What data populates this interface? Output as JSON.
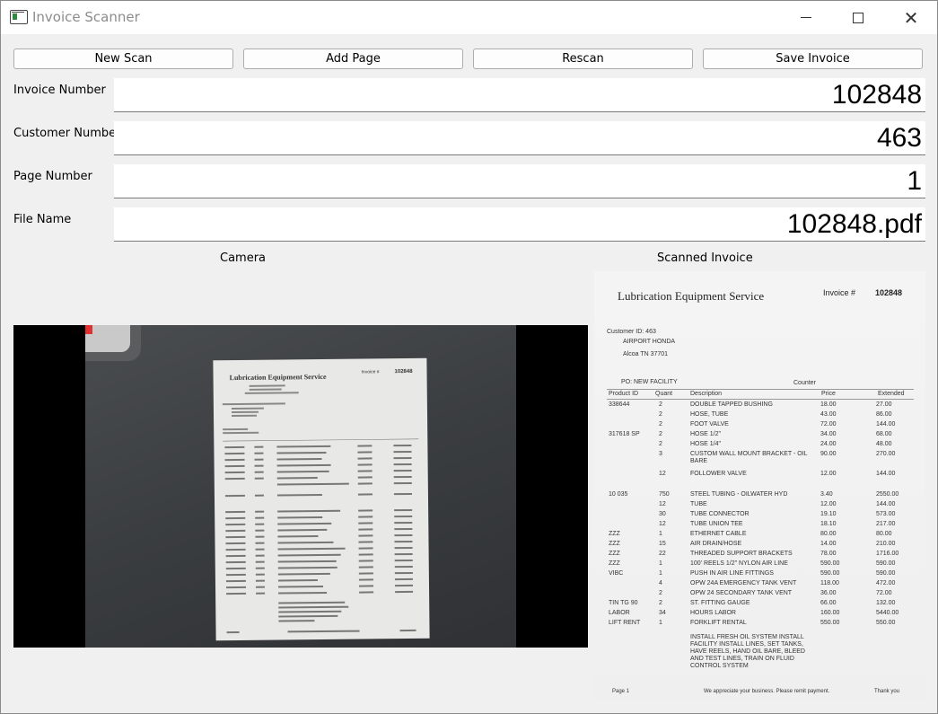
{
  "window": {
    "title": "Invoice Scanner"
  },
  "toolbar": {
    "new_scan": "New Scan",
    "add_page": "Add Page",
    "rescan": "Rescan",
    "save_invoice": "Save Invoice"
  },
  "form": {
    "invoice_number_label": "Invoice Number",
    "invoice_number_value": "102848",
    "customer_number_label": "Customer Number",
    "customer_number_value": "463",
    "page_number_label": "Page Number",
    "page_number_value": "1",
    "file_name_label": "File Name",
    "file_name_value": "102848.pdf"
  },
  "sections": {
    "camera": "Camera",
    "scanned_invoice": "Scanned Invoice"
  },
  "invoice": {
    "company": "Lubrication Equipment Service",
    "invoice_label": "Invoice #",
    "invoice_no": "102848",
    "customer_line": "Customer ID: 463",
    "customer_name": "AIRPORT HONDA",
    "customer_addr": "Alcoa TN 37701",
    "job": "PO: NEW FACILITY",
    "counter": "Counter",
    "headers": [
      "Product ID",
      "Quant",
      "Description",
      "Price",
      "Extended"
    ],
    "rows": [
      [
        "338644",
        "2",
        "DOUBLE TAPPED BUSHING",
        "18.00",
        "27.00"
      ],
      [
        "",
        "2",
        "HOSE, TUBE",
        "43.00",
        "86.00"
      ],
      [
        "",
        "2",
        "FOOT VALVE",
        "72.00",
        "144.00"
      ],
      [
        "317618 SP",
        "2",
        "HOSE 1/2\"",
        "34.00",
        "68.00"
      ],
      [
        "",
        "2",
        "HOSE 1/4\"",
        "24.00",
        "48.00"
      ],
      [
        "",
        "3",
        "CUSTOM WALL MOUNT BRACKET - OIL BARE",
        "90.00",
        "270.00"
      ],
      [
        "",
        "12",
        "FOLLOWER VALVE",
        "12.00",
        "144.00"
      ],
      [
        "10 035",
        "750",
        "STEEL TUBING - OILWATER HYD",
        "3.40",
        "2550.00"
      ],
      [
        "",
        "12",
        "TUBE",
        "12.00",
        "144.00"
      ],
      [
        "",
        "30",
        "TUBE CONNECTOR",
        "19.10",
        "573.00"
      ],
      [
        "",
        "12",
        "TUBE UNION TEE",
        "18.10",
        "217.00"
      ],
      [
        "ZZZ",
        "1",
        "ETHERNET CABLE",
        "80.00",
        "80.00"
      ],
      [
        "ZZZ",
        "15",
        "AIR DRAIN/HOSE",
        "14.00",
        "210.00"
      ],
      [
        "ZZZ",
        "22",
        "THREADED SUPPORT BRACKETS",
        "78.00",
        "1716.00"
      ],
      [
        "ZZZ",
        "1",
        "100' REELS 1/2\" NYLON AIR LINE",
        "590.00",
        "590.00"
      ],
      [
        "VIBC",
        "1",
        "PUSH IN AIR LINE FITTINGS",
        "590.00",
        "590.00"
      ],
      [
        "",
        "4",
        "OPW 24A EMERGENCY TANK VENT",
        "118.00",
        "472.00"
      ],
      [
        "",
        "2",
        "OPW 24 SECONDARY TANK VENT",
        "36.00",
        "72.00"
      ],
      [
        "TIN TG 90",
        "2",
        "ST. FITTING GAUGE",
        "66.00",
        "132.00"
      ],
      [
        "LABOR",
        "34",
        "HOURS LABOR",
        "160.00",
        "5440.00"
      ],
      [
        "LIFT RENT",
        "1",
        "FORKLIFT RENTAL",
        "550.00",
        "550.00"
      ]
    ],
    "note": "INSTALL FRESH OIL SYSTEM INSTALL FACILITY INSTALL LINES, SET TANKS, HAVE REELS, HAND OIL BARE, BLEED AND TEST LINES, TRAIN ON FLUID CONTROL SYSTEM",
    "footer_left": "Page 1",
    "footer_center": "We appreciate your business. Please remit payment.",
    "footer_right": "Thank you"
  },
  "icons": {
    "app": "app-window-icon",
    "minimize": "minimize-icon",
    "maximize": "maximize-icon",
    "close": "close-icon"
  }
}
